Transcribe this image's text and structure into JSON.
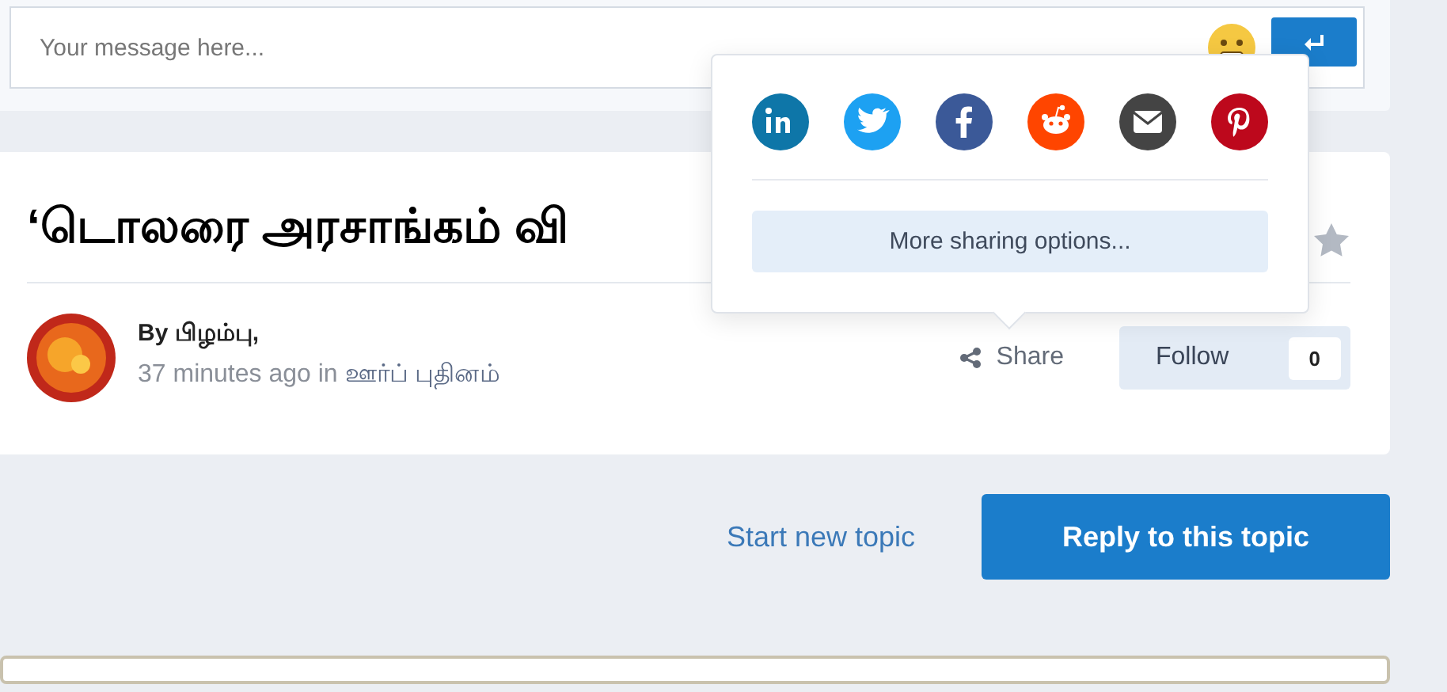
{
  "composer": {
    "placeholder": "Your message here..."
  },
  "topic": {
    "title": "‘டொலரை அரசாங்கம் வி",
    "author": "By பிழம்பு,",
    "time": "37 minutes ago in",
    "forum": "ஊர்ப் புதினம்",
    "share": "Share",
    "follow": "Follow",
    "follow_count": "0"
  },
  "share_popup": {
    "networks": [
      {
        "kind": "linkedin",
        "color": "#0e76a8"
      },
      {
        "kind": "twitter",
        "color": "#1da1f2"
      },
      {
        "kind": "facebook",
        "color": "#3b5998"
      },
      {
        "kind": "reddit",
        "color": "#ff4500"
      },
      {
        "kind": "email",
        "color": "#444444"
      },
      {
        "kind": "pinterest",
        "color": "#bd081c"
      }
    ],
    "more": "More sharing options..."
  },
  "actions": {
    "start": "Start new topic",
    "reply": "Reply to this topic"
  }
}
